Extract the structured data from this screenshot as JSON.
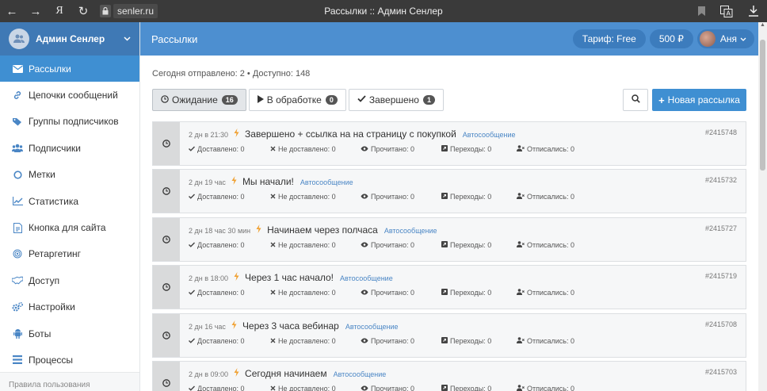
{
  "browser": {
    "title": "Рассылки :: Админ Сенлер",
    "url": "senler.ru",
    "nav": {
      "back": "←",
      "forward": "→",
      "ya": "Я",
      "reload": "↻"
    }
  },
  "sidebar": {
    "user_name": "Админ Сенлер",
    "items": [
      {
        "label": "Рассылки",
        "icon": "envelope-icon"
      },
      {
        "label": "Цепочки сообщений",
        "icon": "link-icon"
      },
      {
        "label": "Группы подписчиков",
        "icon": "tags-icon"
      },
      {
        "label": "Подписчики",
        "icon": "users-icon"
      },
      {
        "label": "Метки",
        "icon": "circle-icon"
      },
      {
        "label": "Статистика",
        "icon": "chart-icon"
      },
      {
        "label": "Кнопка для сайта",
        "icon": "document-icon"
      },
      {
        "label": "Ретаргетинг",
        "icon": "target-icon"
      },
      {
        "label": "Доступ",
        "icon": "handshake-icon"
      },
      {
        "label": "Настройки",
        "icon": "gears-icon"
      },
      {
        "label": "Боты",
        "icon": "android-icon"
      },
      {
        "label": "Процессы",
        "icon": "list-icon"
      }
    ],
    "footer": "Правила пользования"
  },
  "header": {
    "title": "Рассылки",
    "tariff": "Тариф: Free",
    "balance": "500 ₽",
    "user": "Аня"
  },
  "main": {
    "stats": "Сегодня отправлено: 2 • Доступно: 148",
    "filters": [
      {
        "label": "Ожидание",
        "count": "16",
        "icon": "clock"
      },
      {
        "label": "В обработке",
        "count": "0",
        "icon": "play"
      },
      {
        "label": "Завершено",
        "count": "1",
        "icon": "check"
      }
    ],
    "new_button": "Новая рассылка",
    "stat_labels": {
      "delivered": "Доставлено: 0",
      "not_delivered": "Не доставлено: 0",
      "read": "Прочитано: 0",
      "clicks": "Переходы: 0",
      "unsubscribed": "Отписались: 0"
    },
    "cards": [
      {
        "time": "2 дн в 21:30",
        "title": "Завершено + ссылка на на страницу с покупкой",
        "tag": "Автосообщение",
        "id": "#2415748"
      },
      {
        "time": "2 дн 19 час",
        "title": "Мы начали!",
        "tag": "Автосообщение",
        "id": "#2415732"
      },
      {
        "time": "2 дн 18 час 30 мин",
        "title": "Начинаем через полчаса",
        "tag": "Автосообщение",
        "id": "#2415727"
      },
      {
        "time": "2 дн в 18:00",
        "title": "Через 1 час начало!",
        "tag": "Автосообщение",
        "id": "#2415719"
      },
      {
        "time": "2 дн 16 час",
        "title": "Через 3 часа вебинар",
        "tag": "Автосообщение",
        "id": "#2415708"
      },
      {
        "time": "2 дн в 09:00",
        "title": "Сегодня начинаем",
        "tag": "Автосообщение",
        "id": "#2415703"
      }
    ]
  }
}
